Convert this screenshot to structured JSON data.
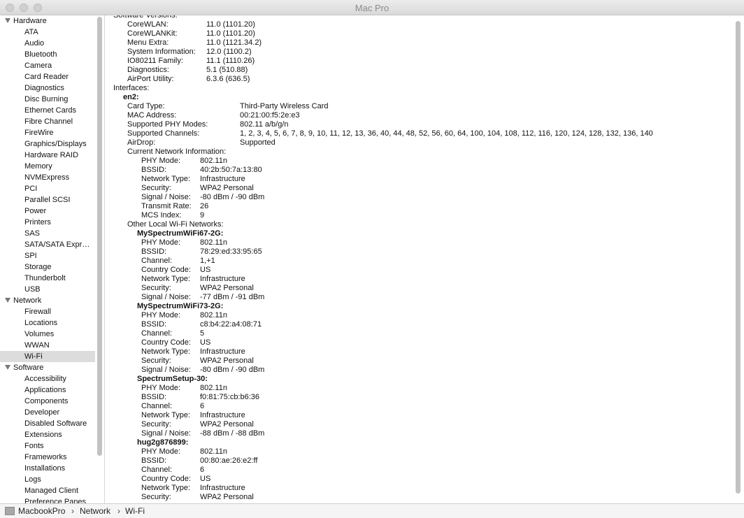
{
  "window": {
    "title": "Mac Pro"
  },
  "sidebar": {
    "categories": [
      {
        "label": "Hardware",
        "items": [
          "ATA",
          "Audio",
          "Bluetooth",
          "Camera",
          "Card Reader",
          "Diagnostics",
          "Disc Burning",
          "Ethernet Cards",
          "Fibre Channel",
          "FireWire",
          "Graphics/Displays",
          "Hardware RAID",
          "Memory",
          "NVMExpress",
          "PCI",
          "Parallel SCSI",
          "Power",
          "Printers",
          "SAS",
          "SATA/SATA Expr…",
          "SPI",
          "Storage",
          "Thunderbolt",
          "USB"
        ]
      },
      {
        "label": "Network",
        "items": [
          "Firewall",
          "Locations",
          "Volumes",
          "WWAN",
          "Wi-Fi"
        ]
      },
      {
        "label": "Software",
        "items": [
          "Accessibility",
          "Applications",
          "Components",
          "Developer",
          "Disabled Software",
          "Extensions",
          "Fonts",
          "Frameworks",
          "Installations",
          "Logs",
          "Managed Client",
          "Preference Panes"
        ]
      }
    ],
    "selected": "Wi-Fi"
  },
  "content": {
    "software_versions_label": "Software Versions:",
    "software_versions": [
      {
        "label": "CoreWLAN:",
        "value": "11.0 (1101.20)"
      },
      {
        "label": "CoreWLANKit:",
        "value": "11.0 (1101.20)"
      },
      {
        "label": "Menu Extra:",
        "value": "11.0 (1121.34.2)"
      },
      {
        "label": "System Information:",
        "value": "12.0 (1100.2)"
      },
      {
        "label": "IO80211 Family:",
        "value": "11.1 (1110.26)"
      },
      {
        "label": "Diagnostics:",
        "value": "5.1 (510.88)"
      },
      {
        "label": "AirPort Utility:",
        "value": "6.3.6 (636.5)"
      }
    ],
    "interfaces_label": "Interfaces:",
    "interface_name": "en2:",
    "interface_props": [
      {
        "label": "Card Type:",
        "value": "Third-Party Wireless Card"
      },
      {
        "label": "MAC Address:",
        "value": "00:21:00:f5:2e:e3"
      },
      {
        "label": "Supported PHY Modes:",
        "value": "802.11 a/b/g/n"
      },
      {
        "label": "Supported Channels:",
        "value": "1, 2, 3, 4, 5, 6, 7, 8, 9, 10, 11, 12, 13, 36, 40, 44, 48, 52, 56, 60, 64, 100, 104, 108, 112, 116, 120, 124, 128, 132, 136, 140"
      },
      {
        "label": "AirDrop:",
        "value": "Supported"
      }
    ],
    "current_network_label": "Current Network Information:",
    "current_network": [
      {
        "label": "PHY Mode:",
        "value": "802.11n"
      },
      {
        "label": "BSSID:",
        "value": "40:2b:50:7a:13:80"
      },
      {
        "label": "Network Type:",
        "value": "Infrastructure"
      },
      {
        "label": "Security:",
        "value": "WPA2 Personal"
      },
      {
        "label": "Signal / Noise:",
        "value": "-80 dBm / -90 dBm"
      },
      {
        "label": "Transmit Rate:",
        "value": "26"
      },
      {
        "label": "MCS Index:",
        "value": "9"
      }
    ],
    "other_networks_label": "Other Local Wi-Fi Networks:",
    "other_networks": [
      {
        "name": "MySpectrumWiFi67-2G:",
        "props": [
          {
            "label": "PHY Mode:",
            "value": "802.11n"
          },
          {
            "label": "BSSID:",
            "value": "78:29:ed:33:95:65"
          },
          {
            "label": "Channel:",
            "value": "1,+1"
          },
          {
            "label": "Country Code:",
            "value": "US"
          },
          {
            "label": "Network Type:",
            "value": "Infrastructure"
          },
          {
            "label": "Security:",
            "value": "WPA2 Personal"
          },
          {
            "label": "Signal / Noise:",
            "value": "-77 dBm / -91 dBm"
          }
        ]
      },
      {
        "name": "MySpectrumWiFi73-2G:",
        "props": [
          {
            "label": "PHY Mode:",
            "value": "802.11n"
          },
          {
            "label": "BSSID:",
            "value": "c8:b4:22:a4:08:71"
          },
          {
            "label": "Channel:",
            "value": "5"
          },
          {
            "label": "Country Code:",
            "value": "US"
          },
          {
            "label": "Network Type:",
            "value": "Infrastructure"
          },
          {
            "label": "Security:",
            "value": "WPA2 Personal"
          },
          {
            "label": "Signal / Noise:",
            "value": "-80 dBm / -90 dBm"
          }
        ]
      },
      {
        "name": "SpectrumSetup-30:",
        "props": [
          {
            "label": "PHY Mode:",
            "value": "802.11n"
          },
          {
            "label": "BSSID:",
            "value": "f0:81:75:cb:b6:36"
          },
          {
            "label": "Channel:",
            "value": "6"
          },
          {
            "label": "Network Type:",
            "value": "Infrastructure"
          },
          {
            "label": "Security:",
            "value": "WPA2 Personal"
          },
          {
            "label": "Signal / Noise:",
            "value": "-88 dBm / -88 dBm"
          }
        ]
      },
      {
        "name": "hug2g876899:",
        "props": [
          {
            "label": "PHY Mode:",
            "value": "802.11n"
          },
          {
            "label": "BSSID:",
            "value": "00:80:ae:26:e2:ff"
          },
          {
            "label": "Channel:",
            "value": "6"
          },
          {
            "label": "Country Code:",
            "value": "US"
          },
          {
            "label": "Network Type:",
            "value": "Infrastructure"
          },
          {
            "label": "Security:",
            "value": "WPA2 Personal"
          }
        ]
      }
    ]
  },
  "breadcrumb": {
    "items": [
      "MacbookPro",
      "Network",
      "Wi-Fi"
    ],
    "separator": "›",
    "icon": "computer-icon"
  }
}
